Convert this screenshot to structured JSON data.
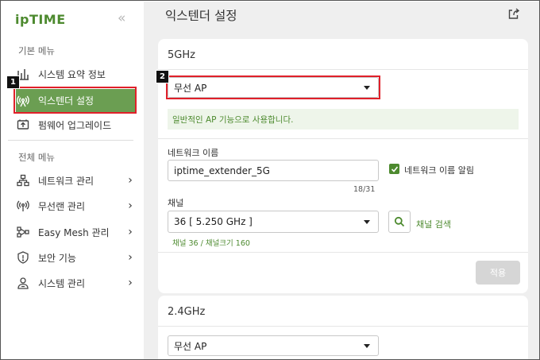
{
  "sidebar": {
    "logo": "ipTIME",
    "collapse_icon": "chevron-double-left",
    "basic_menu_title": "기본 메뉴",
    "basic_items": [
      {
        "label": "시스템 요약 정보",
        "icon": "bar-chart-icon"
      },
      {
        "label": "익스텐더 설정",
        "icon": "antenna-icon",
        "active": true
      },
      {
        "label": "펌웨어 업그레이드",
        "icon": "upgrade-icon"
      }
    ],
    "full_menu_title": "전체 메뉴",
    "full_items": [
      {
        "label": "네트워크 관리",
        "icon": "network-icon"
      },
      {
        "label": "무선랜 관리",
        "icon": "wireless-icon"
      },
      {
        "label": "Easy Mesh 관리",
        "icon": "mesh-icon"
      },
      {
        "label": "보안 기능",
        "icon": "shield-icon"
      },
      {
        "label": "시스템 관리",
        "icon": "system-icon"
      }
    ]
  },
  "badges": {
    "one": "1",
    "two": "2"
  },
  "main": {
    "title": "익스텐더 설정",
    "card_5g": {
      "title": "5GHz",
      "mode_value": "무선 AP",
      "info_text": "일반적인 AP 기능으로 사용합니다.",
      "ssid_label": "네트워크 이름",
      "ssid_value": "iptime_extender_5G",
      "ssid_counter": "18/31",
      "broadcast_label": "네트워크 이름 알림",
      "channel_label": "채널",
      "channel_value": "36 [ 5.250 GHz ]",
      "channel_search_label": "채널 검색",
      "channel_info": "채널 36 / 채널크기 160",
      "apply_label": "적용"
    },
    "card_24g": {
      "title": "2.4GHz",
      "mode_value": "무선 AP"
    }
  },
  "colors": {
    "accent": "#4d8a2f",
    "active_bg": "#6b9e52",
    "highlight": "#e0202a"
  }
}
